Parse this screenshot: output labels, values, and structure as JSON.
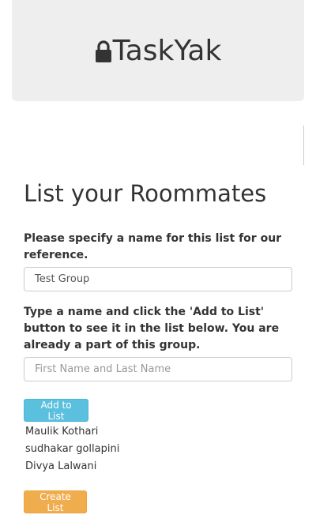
{
  "header": {
    "brand": "TaskYak",
    "icon": "lock-icon"
  },
  "main": {
    "title": "List your Roommates",
    "group_label": "Please specify a name for this list for our reference.",
    "group_value": "Test Group",
    "roommate_label": "Type a name and click the 'Add to List' button to see it in the list below. You are already a part of this group.",
    "roommate_placeholder": "First Name and Last Name",
    "add_button": "Add to List",
    "roommates": [
      "Maulik Kothari",
      "sudhakar gollapini",
      "Divya Lalwani"
    ],
    "create_button": "Create List"
  },
  "colors": {
    "info": "#5bc0de",
    "warning": "#f0ad4e",
    "jumbotron": "#eeeeee"
  }
}
